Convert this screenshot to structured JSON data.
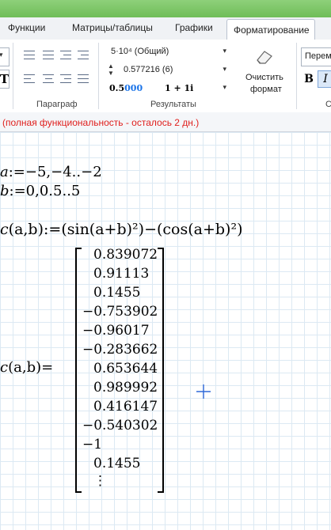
{
  "tabs": [
    "Функции",
    "Матрицы/таблицы",
    "Графики",
    "Форматирование"
  ],
  "active_tab": "Форматирование",
  "ribbon": {
    "number_format": "5·10⁴ (Общий)",
    "precision": "0.577216 (6)",
    "threshold_label": "0.5",
    "threshold_value": "000",
    "complex_format": "1 + 1i",
    "clear_format_line1": "Очистить",
    "clear_format_line2": "формат",
    "style_box": "Перем",
    "bold": "B",
    "italic": "I",
    "groups": {
      "paragraph": "Параграф",
      "results": "Результаты",
      "style": "С"
    }
  },
  "notice": "(полная функциональность - осталось 2 дн.)",
  "worksheet": {
    "def_a": ":=−5,−4..−2",
    "def_b": ":=0,0.5..5",
    "func_def": "(a,b):=(sin(a+b)²)−(cos(a+b)²)",
    "func_eval": "(a,b)=",
    "results": [
      "0.839072",
      "0.91113",
      "0.1455",
      "−0.753902",
      "−0.96017",
      "−0.283662",
      "0.653644",
      "0.989992",
      "0.416147",
      "−0.540302",
      "−1",
      "0.1455",
      "⋮"
    ]
  },
  "colors": {
    "accent": "#6fbd58",
    "notice": "#e0201e",
    "grid": "#dce9f3",
    "cursor": "#2f68d8",
    "threshold_blue": "#1a73e8"
  }
}
